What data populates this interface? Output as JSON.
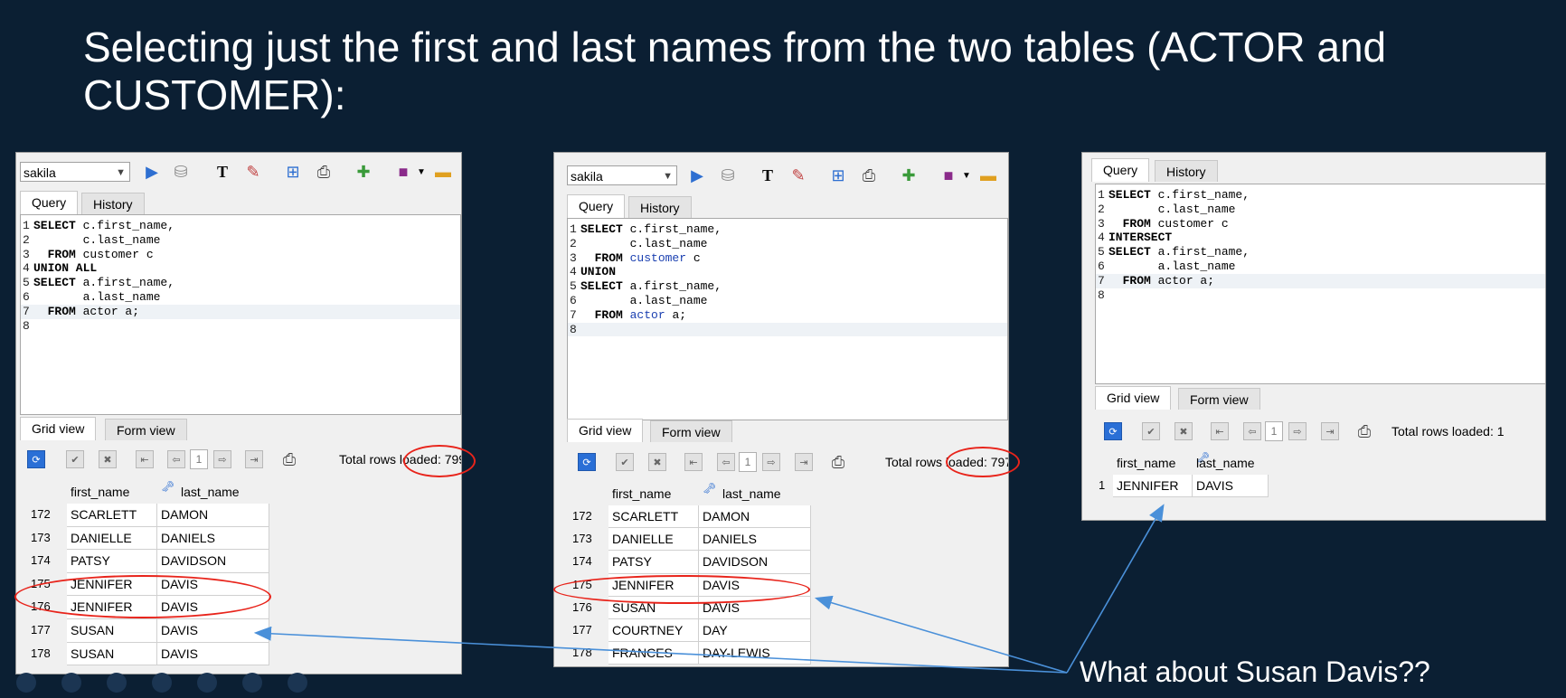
{
  "slide": {
    "title": "Selecting just the first and last names from the two tables (ACTOR and CUSTOMER):",
    "caption": "What about Susan Davis??"
  },
  "common": {
    "db": "sakila",
    "tab_query": "Query",
    "tab_history": "History",
    "tab_grid": "Grid view",
    "tab_form": "Form view",
    "page_no": "1",
    "col_first": "first_name",
    "col_last": "last_name"
  },
  "panel1": {
    "query": [
      {
        "n": "1",
        "kw": "SELECT",
        "rest": " c.first_name,",
        "tbl": "",
        "tail": ""
      },
      {
        "n": "2",
        "kw": "",
        "rest": "       c.last_name",
        "tbl": "",
        "tail": ""
      },
      {
        "n": "3",
        "kw": "  FROM",
        "rest": " customer c",
        "tbl": "",
        "tail": ""
      },
      {
        "n": "4",
        "kw": "UNION ALL",
        "rest": "",
        "tbl": "",
        "tail": ""
      },
      {
        "n": "5",
        "kw": "SELECT",
        "rest": " a.first_name,",
        "tbl": "",
        "tail": ""
      },
      {
        "n": "6",
        "kw": "",
        "rest": "       a.last_name",
        "tbl": "",
        "tail": ""
      },
      {
        "n": "7",
        "kw": "  FROM",
        "rest": " actor a;",
        "tbl": "",
        "tail": ""
      },
      {
        "n": "8",
        "kw": "",
        "rest": "",
        "tbl": "",
        "tail": ""
      }
    ],
    "total": "Total rows loaded: 799",
    "rows": [
      {
        "n": "172",
        "first": "SCARLETT",
        "last": "DAMON"
      },
      {
        "n": "173",
        "first": "DANIELLE",
        "last": "DANIELS"
      },
      {
        "n": "174",
        "first": "PATSY",
        "last": "DAVIDSON"
      },
      {
        "n": "175",
        "first": "JENNIFER",
        "last": "DAVIS"
      },
      {
        "n": "176",
        "first": "JENNIFER",
        "last": "DAVIS"
      },
      {
        "n": "177",
        "first": "SUSAN",
        "last": "DAVIS"
      },
      {
        "n": "178",
        "first": "SUSAN",
        "last": "DAVIS"
      }
    ]
  },
  "panel2": {
    "query": [
      {
        "n": "1",
        "kw": "SELECT",
        "rest": " c.first_name,",
        "tbl": "",
        "tail": ""
      },
      {
        "n": "2",
        "kw": "",
        "rest": "       c.last_name",
        "tbl": "",
        "tail": ""
      },
      {
        "n": "3",
        "kw": "  FROM",
        "rest": " ",
        "tbl": "customer",
        "tail": " c"
      },
      {
        "n": "4",
        "kw": "UNION",
        "rest": "",
        "tbl": "",
        "tail": ""
      },
      {
        "n": "5",
        "kw": "SELECT",
        "rest": " a.first_name,",
        "tbl": "",
        "tail": ""
      },
      {
        "n": "6",
        "kw": "",
        "rest": "       a.last_name",
        "tbl": "",
        "tail": ""
      },
      {
        "n": "7",
        "kw": "  FROM",
        "rest": " ",
        "tbl": "actor",
        "tail": " a;"
      },
      {
        "n": "8",
        "kw": "",
        "rest": "",
        "tbl": "",
        "tail": ""
      }
    ],
    "total": "Total rows loaded: 797",
    "rows": [
      {
        "n": "172",
        "first": "SCARLETT",
        "last": "DAMON"
      },
      {
        "n": "173",
        "first": "DANIELLE",
        "last": "DANIELS"
      },
      {
        "n": "174",
        "first": "PATSY",
        "last": "DAVIDSON"
      },
      {
        "n": "175",
        "first": "JENNIFER",
        "last": "DAVIS"
      },
      {
        "n": "176",
        "first": "SUSAN",
        "last": "DAVIS"
      },
      {
        "n": "177",
        "first": "COURTNEY",
        "last": "DAY"
      },
      {
        "n": "178",
        "first": "FRANCES",
        "last": "DAY-LEWIS"
      }
    ]
  },
  "panel3": {
    "query": [
      {
        "n": "1",
        "kw": "SELECT",
        "rest": " c.first_name,",
        "tbl": "",
        "tail": ""
      },
      {
        "n": "2",
        "kw": "",
        "rest": "       c.last_name",
        "tbl": "",
        "tail": ""
      },
      {
        "n": "3",
        "kw": "  FROM",
        "rest": " customer c",
        "tbl": "",
        "tail": ""
      },
      {
        "n": "4",
        "kw": "INTERSECT",
        "rest": "",
        "tbl": "",
        "tail": ""
      },
      {
        "n": "5",
        "kw": "SELECT",
        "rest": " a.first_name,",
        "tbl": "",
        "tail": ""
      },
      {
        "n": "6",
        "kw": "",
        "rest": "       a.last_name",
        "tbl": "",
        "tail": ""
      },
      {
        "n": "7",
        "kw": "  FROM",
        "rest": " actor a;",
        "tbl": "",
        "tail": ""
      },
      {
        "n": "8",
        "kw": "",
        "rest": "",
        "tbl": "",
        "tail": ""
      }
    ],
    "total": "Total rows loaded: 1",
    "rows": [
      {
        "n": "1",
        "first": "JENNIFER",
        "last": "DAVIS"
      }
    ]
  },
  "colors": {
    "background": "#0b1f33",
    "highlight": "#e8241b",
    "arrow": "#4a90d9",
    "keyword_table": "#1a3fb0"
  }
}
